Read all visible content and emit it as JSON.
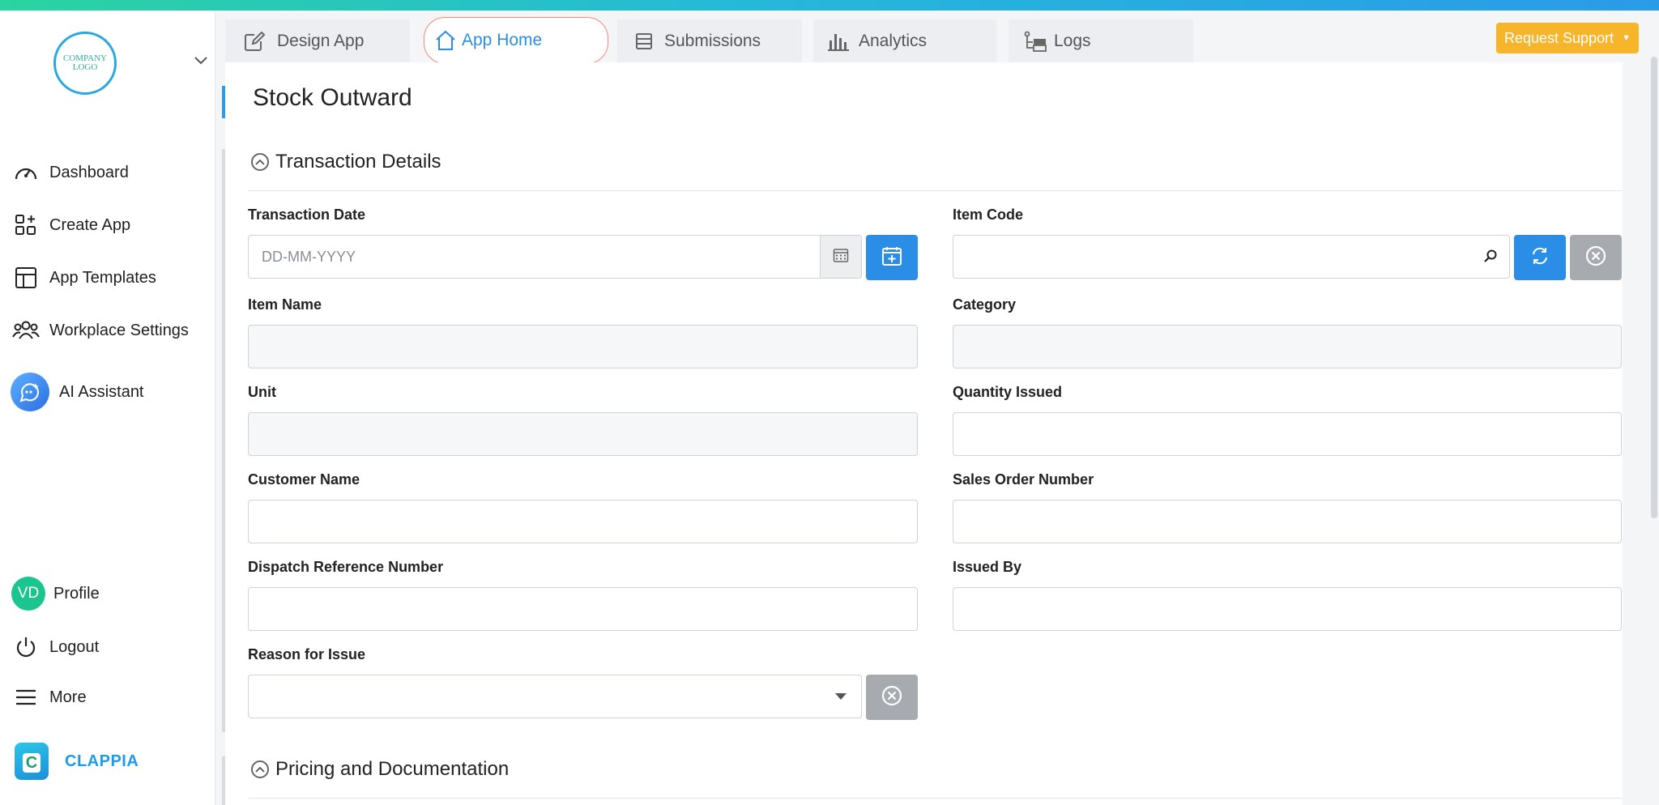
{
  "sidebar": {
    "logo_text": "COMPANY LOGO",
    "items": [
      {
        "label": "Dashboard"
      },
      {
        "label": "Create App"
      },
      {
        "label": "App Templates"
      },
      {
        "label": "Workplace Settings"
      },
      {
        "label": "AI Assistant"
      }
    ],
    "profile": {
      "initials": "VD",
      "label": "Profile"
    },
    "logout_label": "Logout",
    "more_label": "More",
    "brand_name": "CLAPPIA"
  },
  "tabs": [
    {
      "label": "Design App",
      "icon": "edit-icon"
    },
    {
      "label": "App Home",
      "icon": "home-icon",
      "active": true
    },
    {
      "label": "Submissions",
      "icon": "list-icon"
    },
    {
      "label": "Analytics",
      "icon": "bar-chart-icon"
    },
    {
      "label": "Logs",
      "icon": "logs-icon"
    }
  ],
  "support_button": "Request Support",
  "page_title": "Stock Outward",
  "sections": {
    "transaction": "Transaction Details",
    "pricing": "Pricing and Documentation"
  },
  "fields": {
    "transaction_date": {
      "label": "Transaction Date",
      "placeholder": "DD-MM-YYYY"
    },
    "item_code": {
      "label": "Item Code"
    },
    "item_name": {
      "label": "Item Name"
    },
    "category": {
      "label": "Category"
    },
    "unit": {
      "label": "Unit"
    },
    "quantity_issued": {
      "label": "Quantity Issued"
    },
    "customer_name": {
      "label": "Customer Name"
    },
    "sales_order_number": {
      "label": "Sales Order Number"
    },
    "dispatch_reference": {
      "label": "Dispatch Reference Number"
    },
    "issued_by": {
      "label": "Issued By"
    },
    "reason_for_issue": {
      "label": "Reason for Issue"
    }
  },
  "colors": {
    "accent": "#2a8ee6",
    "support": "#f6b52a",
    "avatar": "#1cc58d"
  }
}
